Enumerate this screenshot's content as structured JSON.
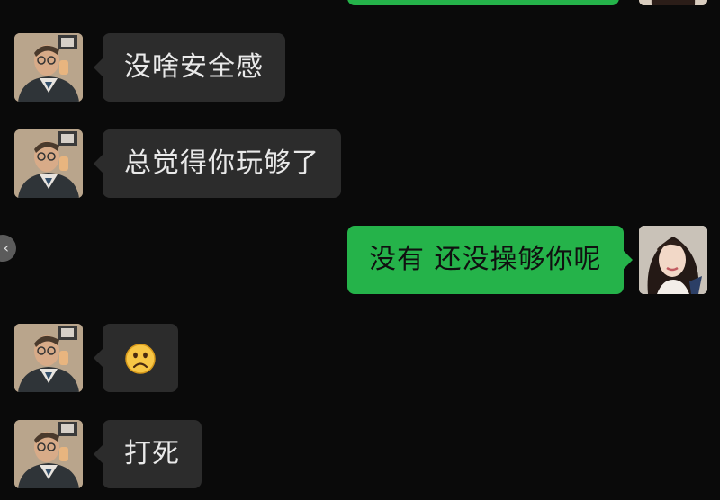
{
  "chat": {
    "messages": [
      {
        "side": "outgoing",
        "text": ""
      },
      {
        "side": "incoming",
        "text": "没啥安全感"
      },
      {
        "side": "incoming",
        "text": "总觉得你玩够了"
      },
      {
        "side": "outgoing",
        "text": "没有 还没操够你呢"
      },
      {
        "side": "incoming",
        "emoji": "frowning-face-emoji"
      },
      {
        "side": "incoming",
        "text": "打死"
      }
    ]
  },
  "ui": {
    "back_handle_glyph": "‹"
  },
  "colors": {
    "background": "#0a0a0a",
    "incoming_bubble": "#2c2c2c",
    "outgoing_bubble": "#25b34a",
    "text_light": "#e9e9e9",
    "text_dark": "#101010"
  }
}
